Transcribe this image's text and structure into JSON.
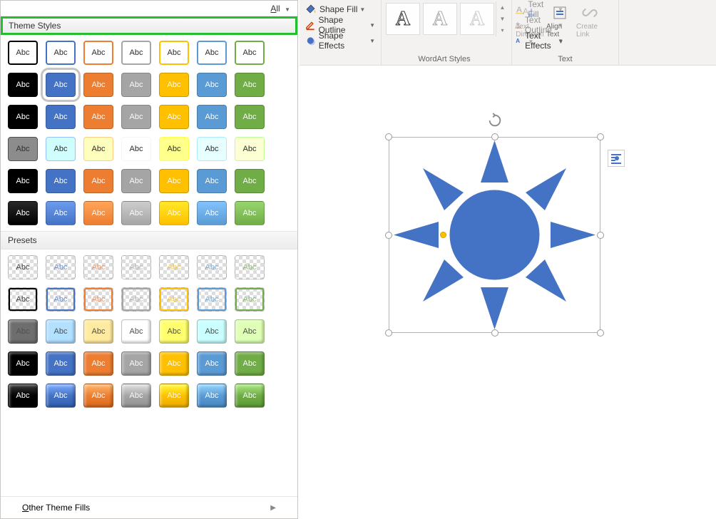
{
  "ribbon": {
    "shapeFill": "Shape Fill",
    "shapeOutline": "Shape Outline",
    "shapeEffects": "Shape Effects",
    "wordartLabel": "WordArt Styles",
    "textFill": "Text Fill",
    "textOutline": "Text Outline",
    "textEffects": "Text Effects",
    "textDirection": "Text Direction",
    "alignText": "Align Text",
    "createLink": "Create Link",
    "textGroupLabel": "Text",
    "wordartSample": "A"
  },
  "dropdown": {
    "allLabel": "All",
    "themeStylesLabel": "Theme Styles",
    "presetsLabel": "Presets",
    "otherFillsLabel": "Other Theme Fills",
    "swatchText": "Abc",
    "themeColors": [
      "#000000",
      "#4472c4",
      "#ed7d31",
      "#a5a5a5",
      "#ffc000",
      "#5b9bd5",
      "#70ad47"
    ],
    "themeRows": [
      {
        "type": "outline-only"
      },
      {
        "type": "solid",
        "selectedIndex": 1
      },
      {
        "type": "solid"
      },
      {
        "type": "light"
      },
      {
        "type": "solid"
      },
      {
        "type": "solid-gradient"
      }
    ],
    "presetRows": [
      {
        "type": "checker-text"
      },
      {
        "type": "checker-outline"
      },
      {
        "type": "faded-bevel"
      },
      {
        "type": "solid-bevel"
      },
      {
        "type": "gloss-bevel"
      }
    ]
  },
  "shape": {
    "fillColor": "#4472c4"
  }
}
